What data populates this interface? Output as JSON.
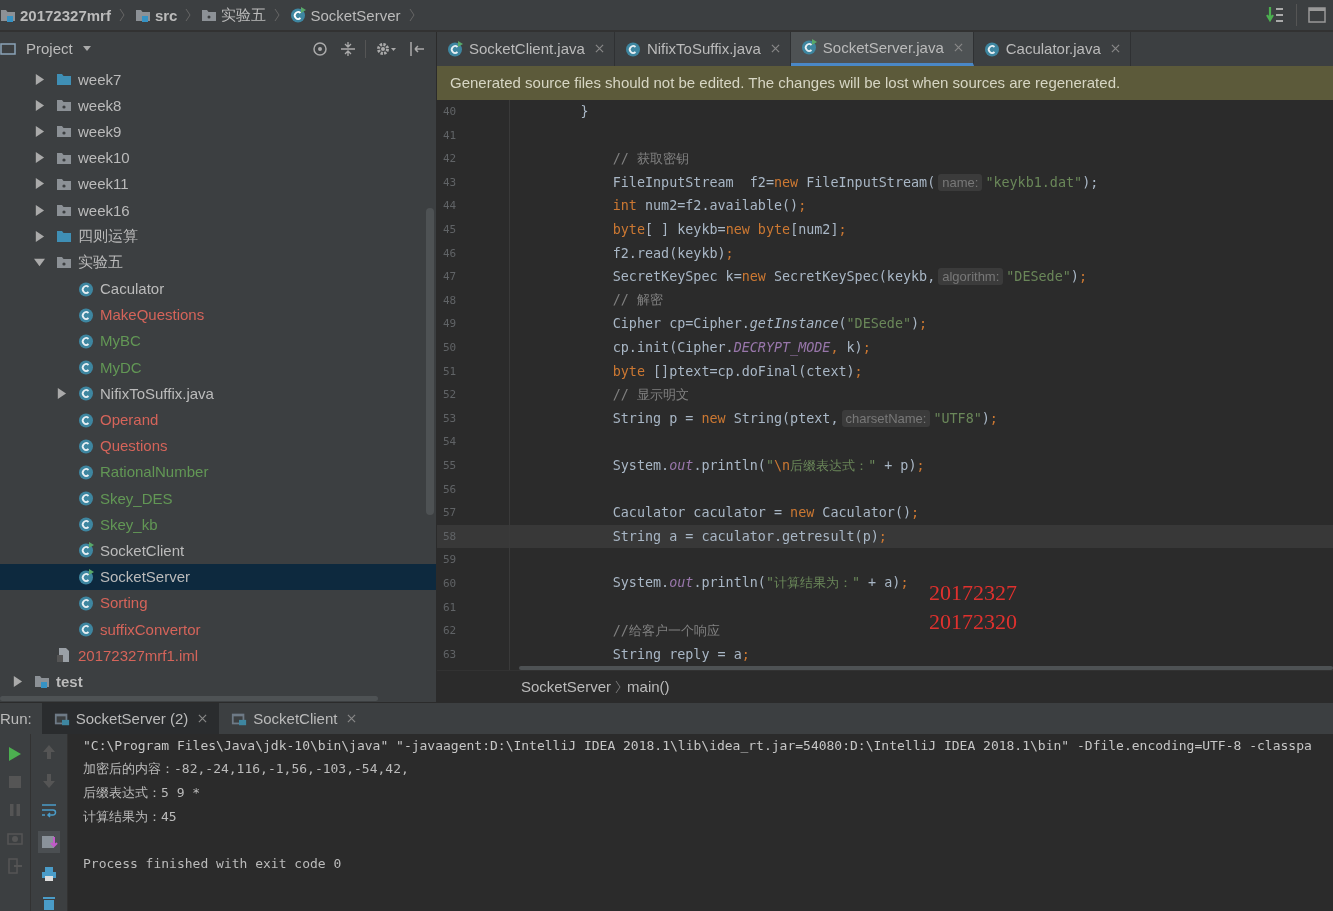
{
  "breadcrumb": [
    {
      "label": "20172327mrf",
      "kind": "module"
    },
    {
      "label": "src",
      "kind": "source"
    },
    {
      "label": "实验五",
      "kind": "package"
    },
    {
      "label": "SocketServer",
      "kind": "runnable-class"
    }
  ],
  "project_panel": {
    "title": "Project"
  },
  "tree": {
    "items": [
      {
        "label": "week7",
        "kind": "folder",
        "expanded": false,
        "selected": false,
        "color": "#bbbbbb"
      },
      {
        "label": "week8",
        "kind": "package",
        "expanded": false,
        "selected": false,
        "color": "#bbbbbb"
      },
      {
        "label": "week9",
        "kind": "package",
        "expanded": false,
        "selected": false,
        "color": "#bbbbbb"
      },
      {
        "label": "week10",
        "kind": "package",
        "expanded": false,
        "selected": false,
        "color": "#bbbbbb"
      },
      {
        "label": "week11",
        "kind": "package",
        "expanded": false,
        "selected": false,
        "color": "#bbbbbb"
      },
      {
        "label": "week16",
        "kind": "package",
        "expanded": false,
        "selected": false,
        "color": "#bbbbbb"
      },
      {
        "label": "四则运算",
        "kind": "folder",
        "expanded": false,
        "selected": false,
        "color": "#bbbbbb"
      },
      {
        "label": "实验五",
        "kind": "package",
        "expanded": true,
        "selected": false,
        "color": "#bbbbbb",
        "children": [
          {
            "label": "Caculator",
            "kind": "class",
            "selected": false,
            "color": "#bbbbbb"
          },
          {
            "label": "MakeQuestions",
            "kind": "class",
            "selected": false,
            "color": "#d5645a"
          },
          {
            "label": "MyBC",
            "kind": "class",
            "selected": false,
            "color": "#629755"
          },
          {
            "label": "MyDC",
            "kind": "class",
            "selected": false,
            "color": "#629755"
          },
          {
            "label": "NifixToSuffix.java",
            "kind": "class",
            "expanded": false,
            "selected": false,
            "color": "#bbbbbb"
          },
          {
            "label": "Operand",
            "kind": "class",
            "selected": false,
            "color": "#d5645a"
          },
          {
            "label": "Questions",
            "kind": "class",
            "selected": false,
            "color": "#d5645a"
          },
          {
            "label": "RationalNumber",
            "kind": "class",
            "selected": false,
            "color": "#629755"
          },
          {
            "label": "Skey_DES",
            "kind": "class",
            "selected": false,
            "color": "#629755"
          },
          {
            "label": "Skey_kb",
            "kind": "class",
            "selected": false,
            "color": "#629755"
          },
          {
            "label": "SocketClient",
            "kind": "runnable-class",
            "selected": false,
            "color": "#bbbbbb"
          },
          {
            "label": "SocketServer",
            "kind": "runnable-class",
            "selected": true,
            "color": "#bbbbbb"
          },
          {
            "label": "Sorting",
            "kind": "class",
            "selected": false,
            "color": "#d5645a"
          },
          {
            "label": "suffixConvertor",
            "kind": "class",
            "selected": false,
            "color": "#d5645a"
          }
        ]
      },
      {
        "label": "20172327mrf1.iml",
        "kind": "module-file",
        "selected": false,
        "color": "#d5645a"
      }
    ],
    "outer_items": [
      {
        "label": "test",
        "kind": "source",
        "expanded": false,
        "selected": false,
        "color": "#bbbbbb"
      }
    ]
  },
  "editor_tabs": [
    {
      "label": "SocketClient.java",
      "kind": "runnable-class",
      "selected": false
    },
    {
      "label": "NifixToSuffix.java",
      "kind": "class",
      "selected": false
    },
    {
      "label": "SocketServer.java",
      "kind": "runnable-class",
      "selected": true
    },
    {
      "label": "Caculator.java",
      "kind": "class",
      "selected": false
    }
  ],
  "banner": "Generated source files should not be edited. The changes will be lost when sources are regenerated.",
  "code_lines": [
    {
      "n": "40",
      "tokens": [
        {
          "text": "        }",
          "kind": "plain"
        }
      ]
    },
    {
      "n": "41"
    },
    {
      "n": "42",
      "tokens": [
        {
          "text": "            // 获取密钥",
          "kind": "comment"
        }
      ]
    },
    {
      "n": "43",
      "tokens": [
        {
          "text": "            FileInputStream  f2=",
          "kind": "plain"
        },
        {
          "text": "new",
          "kind": "keyword"
        },
        {
          "text": " FileInputStream(",
          "kind": "plain"
        },
        {
          "text": "name:",
          "kind": "hint"
        },
        {
          "text": "\"keykb1.dat\"",
          "kind": "string"
        },
        {
          "text": ");",
          "kind": "plain"
        }
      ]
    },
    {
      "n": "44",
      "tokens": [
        {
          "text": "            int",
          "kind": "keyword"
        },
        {
          "text": " num2=f2.available()",
          "kind": "plain"
        },
        {
          "text": ";",
          "kind": "keyword"
        }
      ]
    },
    {
      "n": "45",
      "tokens": [
        {
          "text": "            byte",
          "kind": "keyword"
        },
        {
          "text": "[ ] keykb=",
          "kind": "plain"
        },
        {
          "text": "new byte",
          "kind": "keyword"
        },
        {
          "text": "[num2]",
          "kind": "plain"
        },
        {
          "text": ";",
          "kind": "keyword"
        }
      ]
    },
    {
      "n": "46",
      "tokens": [
        {
          "text": "            f2.read(keykb)",
          "kind": "plain"
        },
        {
          "text": ";",
          "kind": "keyword"
        }
      ]
    },
    {
      "n": "47",
      "tokens": [
        {
          "text": "            SecretKeySpec k=",
          "kind": "plain"
        },
        {
          "text": "new",
          "kind": "keyword"
        },
        {
          "text": " SecretKeySpec(keykb,",
          "kind": "plain"
        },
        {
          "text": "algorithm:",
          "kind": "hint"
        },
        {
          "text": "\"DESede\"",
          "kind": "string"
        },
        {
          "text": ")",
          "kind": "plain"
        },
        {
          "text": ";",
          "kind": "keyword"
        }
      ]
    },
    {
      "n": "48",
      "tokens": [
        {
          "text": "            // 解密",
          "kind": "comment"
        }
      ]
    },
    {
      "n": "49",
      "tokens": [
        {
          "text": "            Cipher cp=Cipher.",
          "kind": "plain"
        },
        {
          "text": "getInstance",
          "kind": "italic"
        },
        {
          "text": "(",
          "kind": "plain"
        },
        {
          "text": "\"DESede\"",
          "kind": "string"
        },
        {
          "text": ")",
          "kind": "plain"
        },
        {
          "text": ";",
          "kind": "keyword"
        }
      ]
    },
    {
      "n": "50",
      "tokens": [
        {
          "text": "            cp.init(Cipher.",
          "kind": "plain"
        },
        {
          "text": "DECRYPT_MODE",
          "kind": "static"
        },
        {
          "text": ",",
          "kind": "keyword"
        },
        {
          "text": " k)",
          "kind": "plain"
        },
        {
          "text": ";",
          "kind": "keyword"
        }
      ]
    },
    {
      "n": "51",
      "tokens": [
        {
          "text": "            byte",
          "kind": "keyword"
        },
        {
          "text": " []ptext=cp.doFinal(ctext)",
          "kind": "plain"
        },
        {
          "text": ";",
          "kind": "keyword"
        }
      ]
    },
    {
      "n": "52",
      "tokens": [
        {
          "text": "            // 显示明文",
          "kind": "comment"
        }
      ]
    },
    {
      "n": "53",
      "tokens": [
        {
          "text": "            String p = ",
          "kind": "plain"
        },
        {
          "text": "new",
          "kind": "keyword"
        },
        {
          "text": " String(ptext,",
          "kind": "plain"
        },
        {
          "text": "charsetName:",
          "kind": "hint"
        },
        {
          "text": "\"UTF8\"",
          "kind": "string"
        },
        {
          "text": ")",
          "kind": "plain"
        },
        {
          "text": ";",
          "kind": "keyword"
        }
      ]
    },
    {
      "n": "54"
    },
    {
      "n": "55",
      "tokens": [
        {
          "text": "            System.",
          "kind": "plain"
        },
        {
          "text": "out",
          "kind": "static"
        },
        {
          "text": ".println(",
          "kind": "plain"
        },
        {
          "text": "\"",
          "kind": "string"
        },
        {
          "text": "\\n",
          "kind": "keyword"
        },
        {
          "text": "后缀表达式：\"",
          "kind": "string"
        },
        {
          "text": " + p)",
          "kind": "plain"
        },
        {
          "text": ";",
          "kind": "keyword"
        }
      ]
    },
    {
      "n": "56"
    },
    {
      "n": "57",
      "tokens": [
        {
          "text": "            Caculator caculator = ",
          "kind": "plain"
        },
        {
          "text": "new",
          "kind": "keyword"
        },
        {
          "text": " Caculator()",
          "kind": "plain"
        },
        {
          "text": ";",
          "kind": "keyword"
        }
      ]
    },
    {
      "n": "58",
      "current": true,
      "tokens": [
        {
          "text": "            String a = caculator.getresult(p)",
          "kind": "plain"
        },
        {
          "text": ";",
          "kind": "keyword"
        }
      ]
    },
    {
      "n": "59"
    },
    {
      "n": "60",
      "tokens": [
        {
          "text": "            System.",
          "kind": "plain"
        },
        {
          "text": "out",
          "kind": "static"
        },
        {
          "text": ".println(",
          "kind": "plain"
        },
        {
          "text": "\"计算结果为：\"",
          "kind": "string"
        },
        {
          "text": " + a)",
          "kind": "plain"
        },
        {
          "text": ";",
          "kind": "keyword"
        }
      ]
    },
    {
      "n": "61"
    },
    {
      "n": "62",
      "tokens": [
        {
          "text": "            //给客户一个响应",
          "kind": "comment"
        }
      ]
    },
    {
      "n": "63",
      "tokens": [
        {
          "text": "            String reply = a",
          "kind": "plain"
        },
        {
          "text": ";",
          "kind": "keyword"
        }
      ]
    }
  ],
  "annotations": [
    "20172327",
    "20172320"
  ],
  "editor_breadcrumb": [
    "SocketServer",
    "main()"
  ],
  "run_panel": {
    "label": "Run:",
    "tabs": [
      {
        "label": "SocketServer (2)",
        "selected": true
      },
      {
        "label": "SocketClient",
        "selected": false
      }
    ],
    "console": [
      {
        "text": "\"C:\\Program Files\\Java\\jdk-10\\bin\\java\" \"-javaagent:D:\\IntelliJ IDEA 2018.1\\lib\\idea_rt.jar=54080:D:\\IntelliJ IDEA 2018.1\\bin\" -Dfile.encoding=UTF-8 -classpa",
        "kind": "command"
      },
      {
        "text": "加密后的内容：-82,-24,116,-1,56,-103,-54,42,",
        "kind": "output"
      },
      {
        "text": "后缀表达式：5 9 *",
        "kind": "output"
      },
      {
        "text": "计算结果为：45",
        "kind": "output"
      },
      {
        "text": "Process finished with exit code 0",
        "kind": "exit"
      }
    ]
  }
}
